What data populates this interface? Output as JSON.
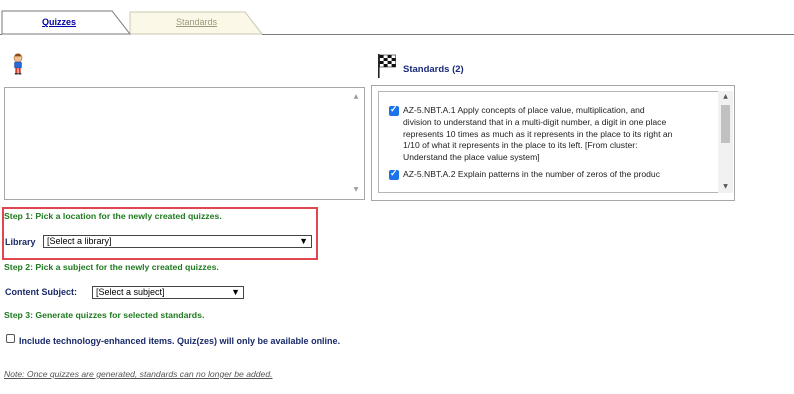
{
  "tabs": {
    "active": "Quizzes",
    "inactive": "Standards"
  },
  "standards_panel": {
    "title": "Standards (2)",
    "items": [
      {
        "text": "AZ-5.NBT.A.1 Apply concepts of place value, multiplication, and\ndivision to understand that in a multi-digit number, a digit in one place\nrepresents 10 times as much as it represents in the place to its right an\n1/10 of what it represents in the place to its left. [From cluster:\nUnderstand the place value system]",
        "checked": true
      },
      {
        "text": "AZ-5.NBT.A.2 Explain patterns in the number of zeros of the produc",
        "checked": true
      }
    ]
  },
  "steps": {
    "step1": "Step 1:  Pick a location for the newly created quizzes.",
    "step2": "Step 2:  Pick a subject for the newly created quizzes.",
    "step3": "Step 3:  Generate quizzes for selected standards."
  },
  "library": {
    "label": "Library",
    "selected": "[Select a library]"
  },
  "content_subject": {
    "label": "Content Subject:",
    "selected": "[Select a subject]"
  },
  "tech_enhanced": {
    "label": "Include technology-enhanced items. Quiz(zes) will only be available online.",
    "checked": false
  },
  "note": "Note: Once quizzes are generated, standards can no longer be added.",
  "colors": {
    "step_green": "#1f7a1f",
    "label_navy": "#1a2a6a",
    "highlight_red": "#e0464e",
    "checkbox_blue": "#1a73e8"
  }
}
